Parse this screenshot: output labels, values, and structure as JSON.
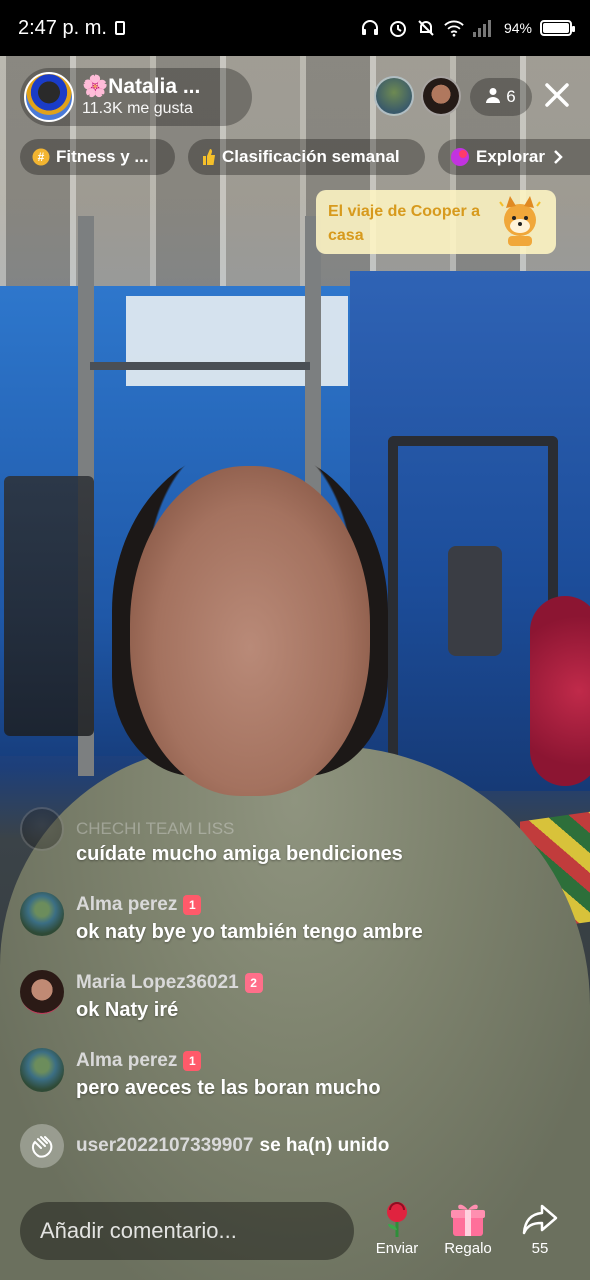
{
  "status_bar": {
    "time": "2:47 p. m.",
    "battery": "94%",
    "battery_level": 0.94
  },
  "host": {
    "name": "🌸Natalia ...",
    "likes": "11.3K me gusta"
  },
  "viewers": {
    "count": "6"
  },
  "chips": [
    {
      "label": "Fitness y ..."
    },
    {
      "label": "Clasificación semanal"
    },
    {
      "label": "Explorar"
    }
  ],
  "promo": {
    "text": "El viaje de Cooper a casa"
  },
  "faded_comment": {
    "user": "CHECHI TEAM LISS"
  },
  "comments": [
    {
      "user": "",
      "text": "cuídate mucho amiga bendiciones"
    },
    {
      "user": "Alma perez",
      "rank": "1",
      "text": "ok naty bye yo también tengo ambre"
    },
    {
      "user": "Maria Lopez36021",
      "rank": "2",
      "text": "ok Naty iré"
    },
    {
      "user": "Alma perez",
      "rank": "1",
      "text": "pero aveces te las boran mucho"
    }
  ],
  "join_notice": {
    "user": "user2022107339907",
    "text": "se ha(n) unido"
  },
  "input": {
    "placeholder": "Añadir comentario..."
  },
  "actions": {
    "send_label": "Enviar",
    "gift_label": "Regalo",
    "share_count": "55"
  }
}
